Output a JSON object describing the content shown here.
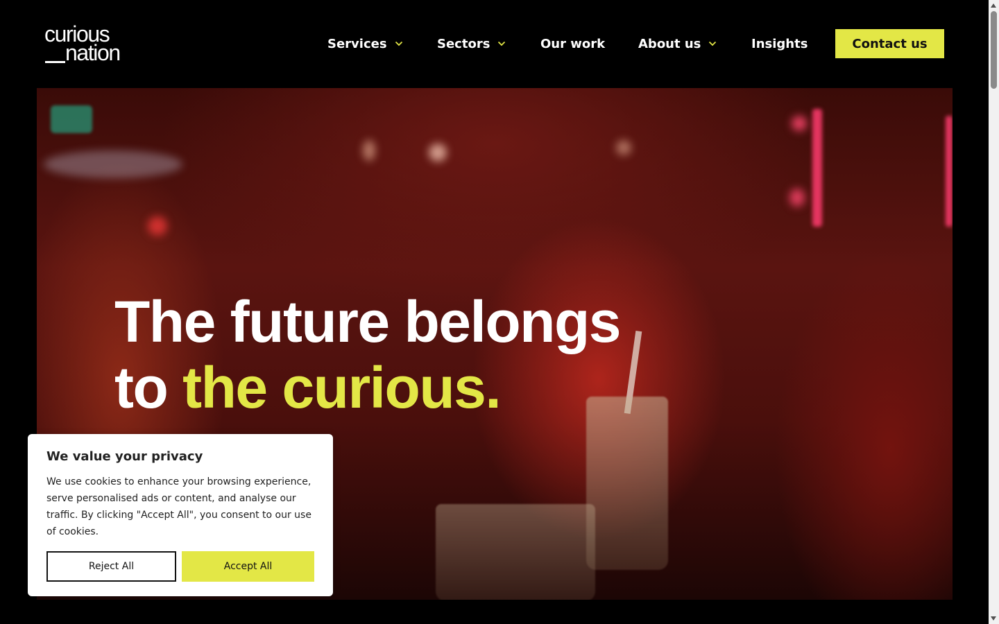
{
  "logo": {
    "line1": "curious",
    "line2": "nation"
  },
  "nav": {
    "items": [
      {
        "label": "Services",
        "has_dropdown": true
      },
      {
        "label": "Sectors",
        "has_dropdown": true
      },
      {
        "label": "Our work",
        "has_dropdown": false
      },
      {
        "label": "About us",
        "has_dropdown": true
      },
      {
        "label": "Insights",
        "has_dropdown": false
      }
    ],
    "contact_label": "Contact us"
  },
  "hero": {
    "line1": "The future belongs",
    "line2_prefix": "to ",
    "line2_accent": "the curious."
  },
  "cookie": {
    "title": "We value your privacy",
    "text": "We use cookies to enhance your browsing experience, serve personalised ads or content, and analyse our traffic. By clicking \"Accept All\", you consent to our use of cookies.",
    "reject_label": "Reject All",
    "accept_label": "Accept All"
  },
  "colors": {
    "accent": "#e3e746",
    "background": "#000000",
    "text_light": "#ffffff"
  },
  "icons": {
    "dropdown": "chevron-down-icon"
  }
}
